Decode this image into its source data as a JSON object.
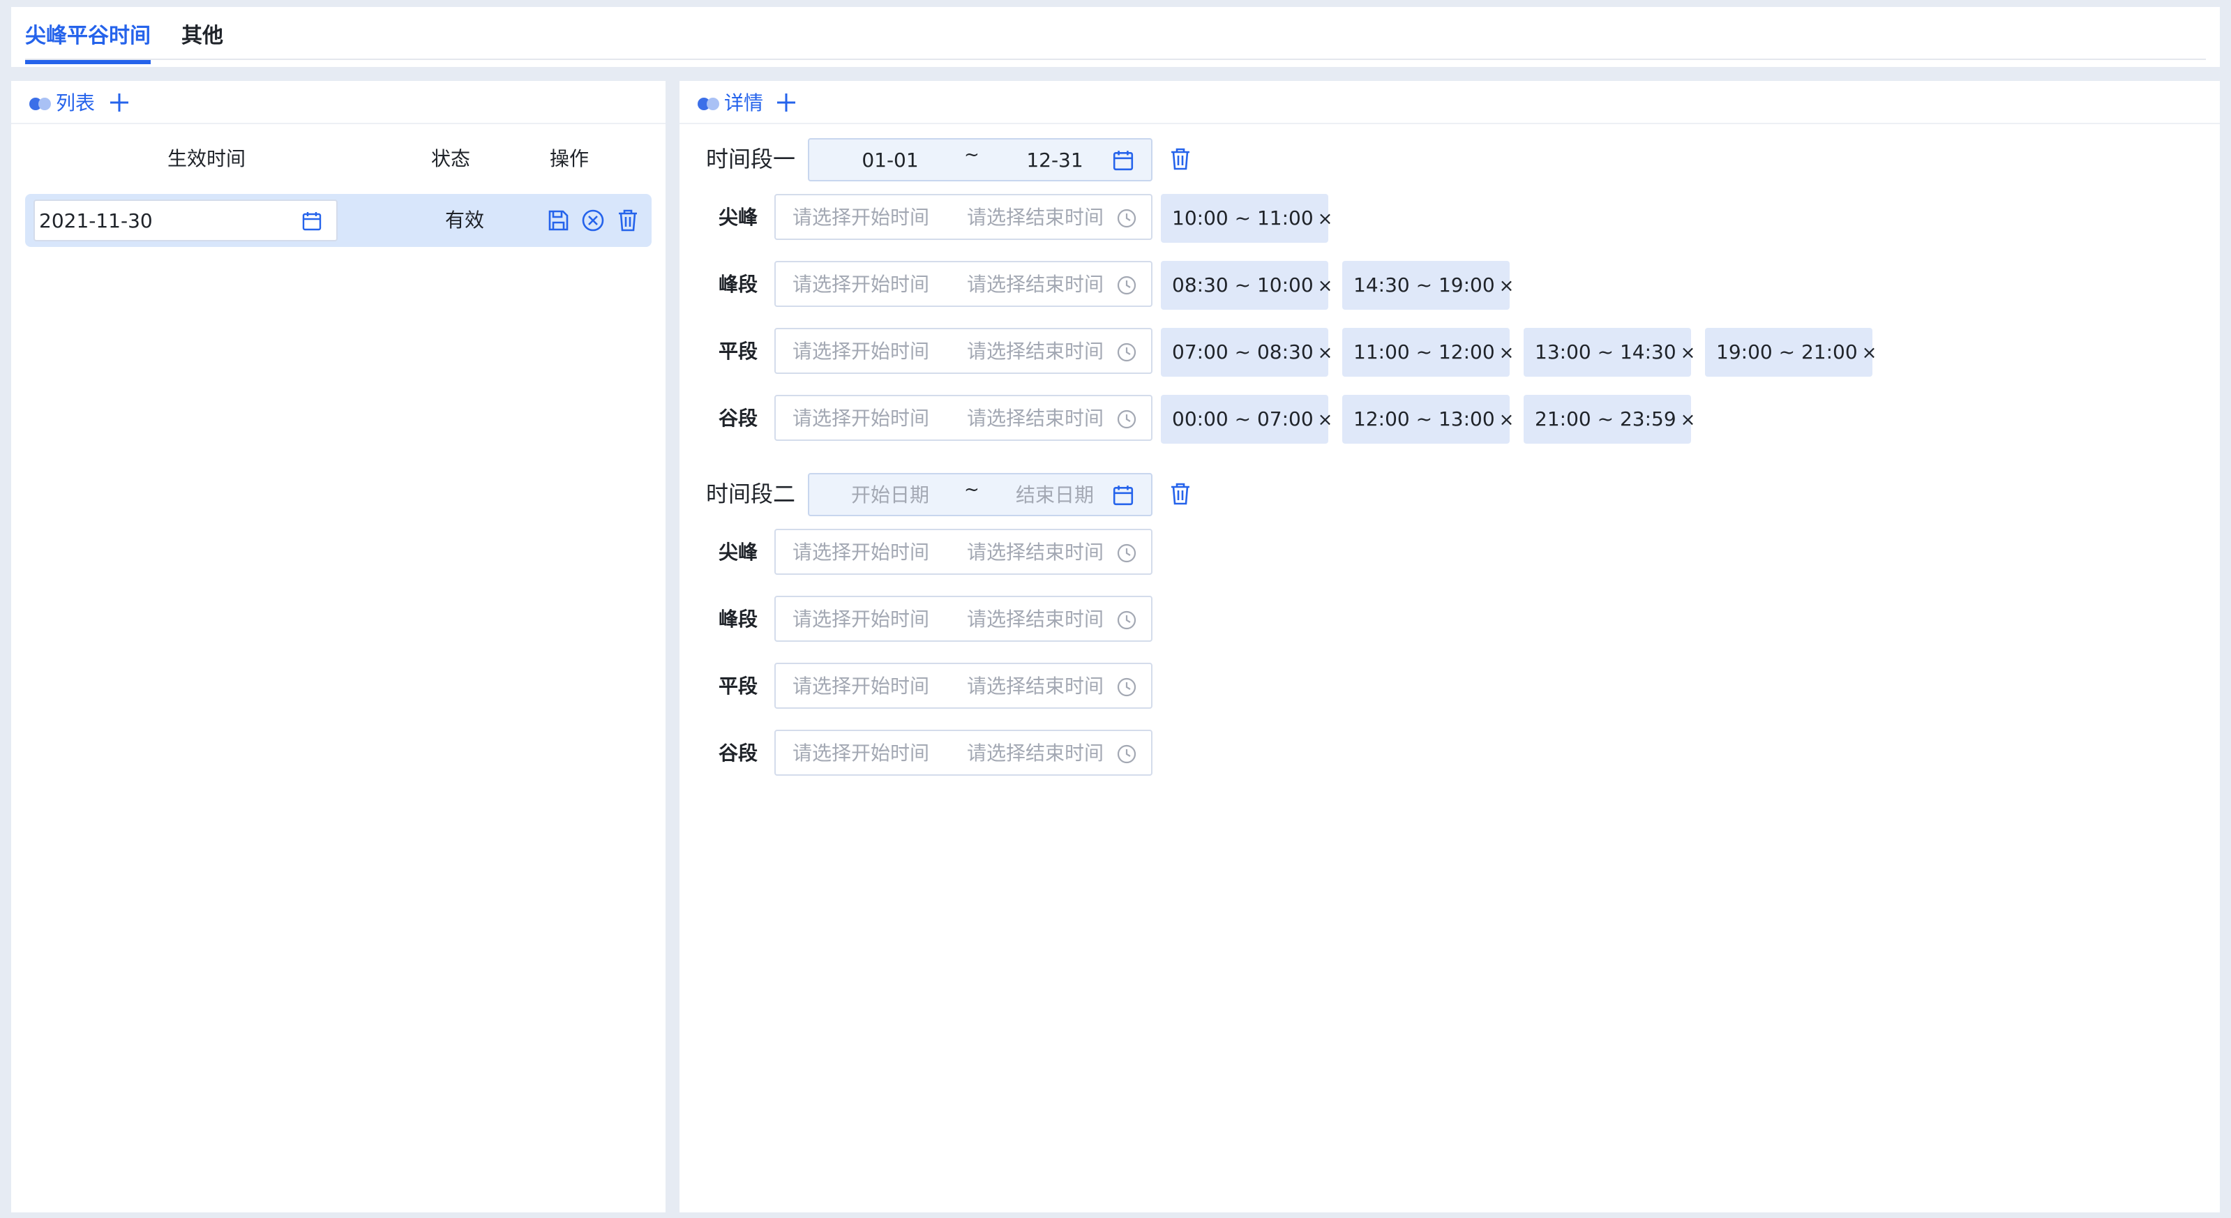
{
  "tabs": [
    {
      "label": "尖峰平谷时间",
      "active": true
    },
    {
      "label": "其他",
      "active": false
    }
  ],
  "list_panel": {
    "title": "列表",
    "columns": [
      "生效时间",
      "状态",
      "操作"
    ],
    "rows": [
      {
        "date": "2021-11-30",
        "status": "有效"
      }
    ]
  },
  "detail_panel": {
    "title": "详情",
    "segments": [
      {
        "label": "时间段一",
        "start": "01-01",
        "end": "12-31",
        "separator": "~",
        "rows": [
          {
            "label": "尖峰",
            "chips": [
              "10:00 ~ 11:00"
            ]
          },
          {
            "label": "峰段",
            "chips": [
              "08:30 ~ 10:00",
              "14:30 ~ 19:00"
            ]
          },
          {
            "label": "平段",
            "chips": [
              "07:00 ~ 08:30",
              "11:00 ~ 12:00",
              "13:00 ~ 14:30",
              "19:00 ~ 21:00"
            ]
          },
          {
            "label": "谷段",
            "chips": [
              "00:00 ~ 07:00",
              "12:00 ~ 13:00",
              "21:00 ~ 23:59"
            ]
          }
        ]
      },
      {
        "label": "时间段二",
        "start_placeholder": "开始日期",
        "end_placeholder": "结束日期",
        "separator": "~",
        "rows": [
          {
            "label": "尖峰",
            "chips": []
          },
          {
            "label": "峰段",
            "chips": []
          },
          {
            "label": "平段",
            "chips": []
          },
          {
            "label": "谷段",
            "chips": []
          }
        ]
      }
    ],
    "time_input": {
      "start_placeholder": "请选择开始时间",
      "end_placeholder": "请选择结束时间"
    },
    "chip_close": "×"
  },
  "colors": {
    "accent": "#2563eb",
    "chip_bg": "#dfe8f9",
    "selected_row": "#d8e6fb"
  },
  "icons": [
    "calendar-icon",
    "clock-icon",
    "trash-icon",
    "save-icon",
    "cancel-circle-icon",
    "plus-icon"
  ]
}
